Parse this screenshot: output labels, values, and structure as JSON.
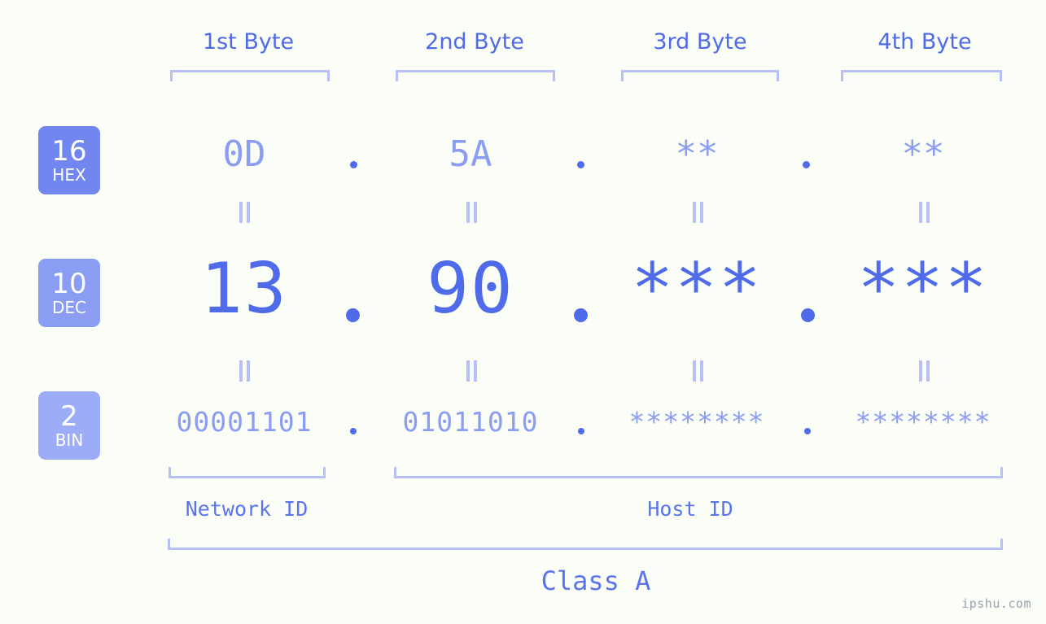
{
  "watermark": "ipshu.com",
  "columns": [
    {
      "header": "1st Byte"
    },
    {
      "header": "2nd Byte"
    },
    {
      "header": "3rd Byte"
    },
    {
      "header": "4th Byte"
    }
  ],
  "rows": {
    "hex": {
      "radix": "16",
      "name": "HEX",
      "values": [
        "0D",
        "5A",
        "**",
        "**"
      ],
      "separator": ".",
      "color": "#7186ee"
    },
    "dec": {
      "radix": "10",
      "name": "DEC",
      "values": [
        "13",
        "90",
        "***",
        "***"
      ],
      "separator": ".",
      "color": "#8b9cf3"
    },
    "bin": {
      "radix": "2",
      "name": "BIN",
      "values": [
        "00001101",
        "01011010",
        "********",
        "********"
      ],
      "separator": ".",
      "color": "#9cacf7"
    }
  },
  "equals_symbol": "=",
  "segments": {
    "network_id": "Network ID",
    "host_id": "Host ID",
    "class": "Class A"
  },
  "colors": {
    "background": "#fbfdf7",
    "accent_strong": "#4f6bea",
    "accent_mid": "#8b9cf3",
    "accent_light": "#b6c0f6",
    "header_text": "#4f6bea"
  }
}
